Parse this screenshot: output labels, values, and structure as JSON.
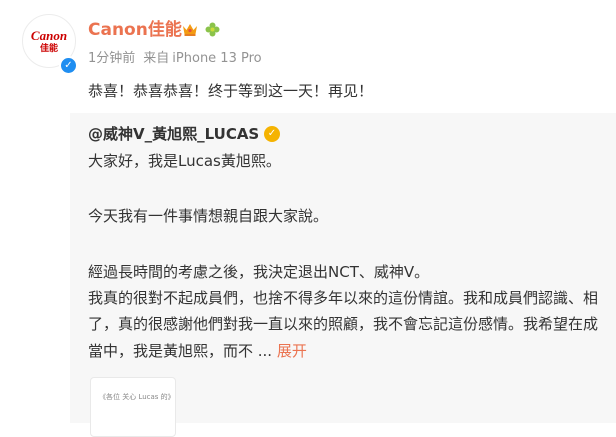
{
  "author": {
    "name": "Canon佳能",
    "avatar_logo": "Canon",
    "avatar_logo_cn": "佳能",
    "icons": [
      "crown-icon",
      "leaf-icon",
      "verified-icon"
    ]
  },
  "meta": {
    "time": "1分钟前",
    "source_label": "来自",
    "source_device": "iPhone 13 Pro"
  },
  "post": {
    "text": "恭喜！恭喜恭喜！终于等到这一天！再见！"
  },
  "repost": {
    "user": "@威神V_黃旭熙_LUCAS",
    "lines": [
      "大家好，我是Lucas黃旭熙。",
      "今天我有一件事情想親自跟大家說。",
      "經過長時間的考慮之後，我決定退出NCT、威神V。",
      "我真的很對不起成員們，也捨不得多年以來的這份情誼。我和成員們認識、相",
      "了，真的很感謝他們對我一直以來的照顧，我不會忘記這份感情。我希望在成",
      "當中，我是黃旭熙，而不  ..."
    ],
    "expand_label": "展开",
    "thumbnail_text": "《各位 关心 Lucas 的》"
  },
  "colors": {
    "accent": "#eb7350",
    "meta_gray": "#939393",
    "repost_bg": "#f7f7f7",
    "verified_blue": "#1f8ef1",
    "verified_gold": "#f5b301"
  }
}
